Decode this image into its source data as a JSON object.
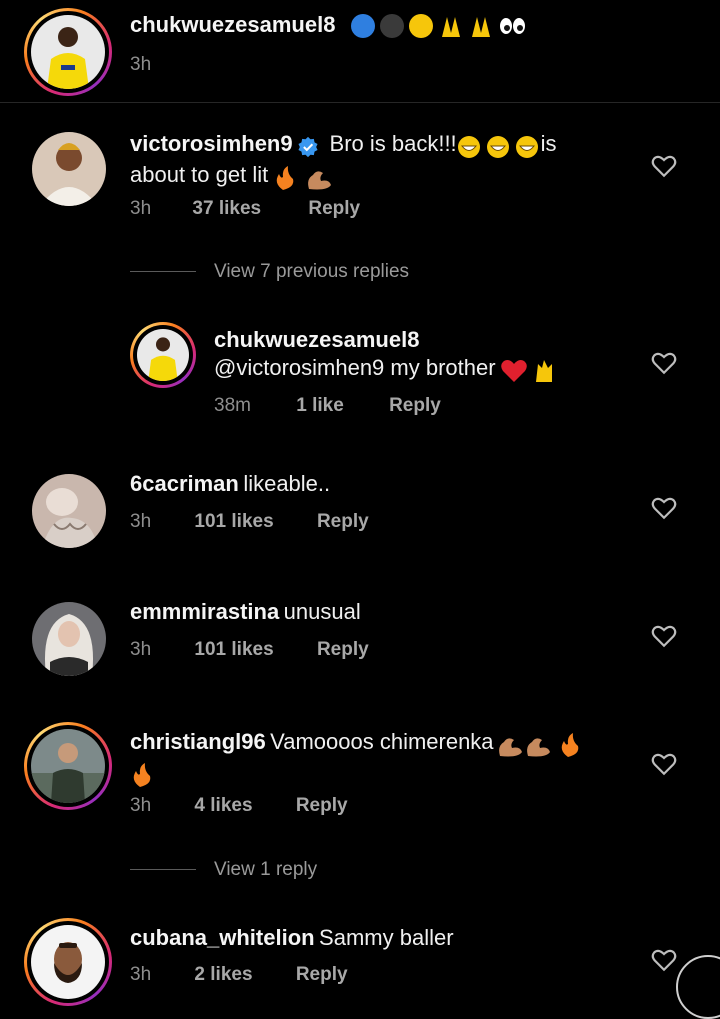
{
  "caption": {
    "username": "chukwuezesamuel8",
    "time": "3h"
  },
  "comments": [
    {
      "username": "victorosimhen9",
      "text_line1": "Bro is back!!!",
      "text_after_emoji": "is",
      "text_line2": "about to get lit",
      "time": "3h",
      "likes": "37 likes",
      "reply": "Reply",
      "view_replies": "View 7 previous replies"
    },
    {
      "username": "chukwuezesamuel8",
      "text": "@victorosimhen9 my brother",
      "time": "38m",
      "likes": "1 like",
      "reply": "Reply"
    },
    {
      "username": "6cacriman",
      "text": "likeable..",
      "time": "3h",
      "likes": "101 likes",
      "reply": "Reply"
    },
    {
      "username": "emmmirastina",
      "text": "unusual",
      "time": "3h",
      "likes": "101 likes",
      "reply": "Reply"
    },
    {
      "username": "christiangl96",
      "text": "Vamoooos chimerenka",
      "time": "3h",
      "likes": "4 likes",
      "reply": "Reply",
      "view_replies": "View 1 reply"
    },
    {
      "username": "cubana_whitelion",
      "text": "Sammy baller",
      "time": "3h",
      "likes": "2 likes",
      "reply": "Reply"
    }
  ],
  "icons": {
    "heart": "heart-outline-icon",
    "verified": "verified-badge-icon"
  },
  "colors": {
    "background": "#000000",
    "verified": "#3897f0",
    "muted": "#8e8e8e"
  }
}
